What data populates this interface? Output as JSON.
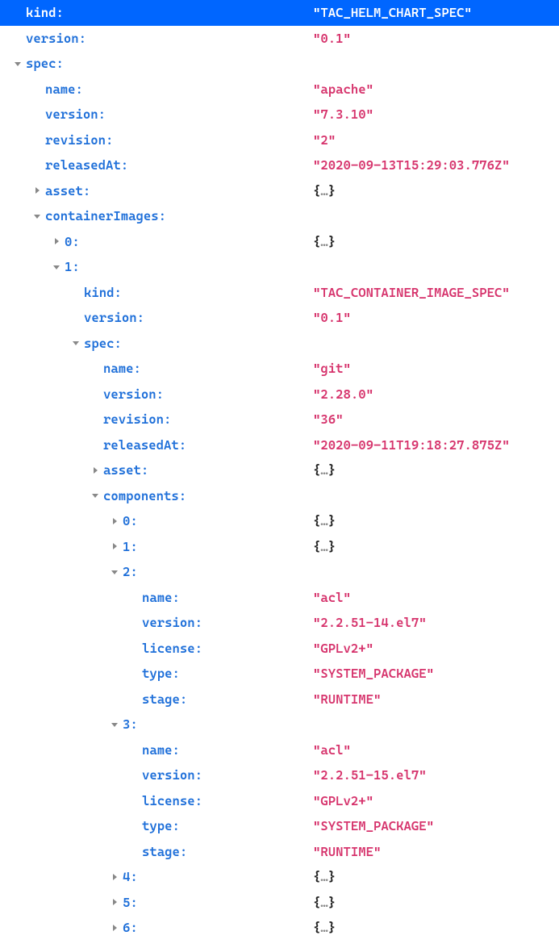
{
  "rows": {
    "r0": {
      "key": "kind:",
      "value": "\"TAC_HELM_CHART_SPEC\""
    },
    "r1": {
      "key": "version:",
      "value": "\"0.1\""
    },
    "r2": {
      "key": "spec:"
    },
    "r3": {
      "key": "name:",
      "value": "\"apache\""
    },
    "r4": {
      "key": "version:",
      "value": "\"7.3.10\""
    },
    "r5": {
      "key": "revision:",
      "value": "\"2\""
    },
    "r6": {
      "key": "releasedAt:",
      "value": "\"2020-09-13T15:29:03.776Z\""
    },
    "r7": {
      "key": "asset:",
      "collapsed": "{…}"
    },
    "r8": {
      "key": "containerImages:"
    },
    "r9": {
      "key": "0:",
      "collapsed": "{…}"
    },
    "r10": {
      "key": "1:"
    },
    "r11": {
      "key": "kind:",
      "value": "\"TAC_CONTAINER_IMAGE_SPEC\""
    },
    "r12": {
      "key": "version:",
      "value": "\"0.1\""
    },
    "r13": {
      "key": "spec:"
    },
    "r14": {
      "key": "name:",
      "value": "\"git\""
    },
    "r15": {
      "key": "version:",
      "value": "\"2.28.0\""
    },
    "r16": {
      "key": "revision:",
      "value": "\"36\""
    },
    "r17": {
      "key": "releasedAt:",
      "value": "\"2020-09-11T19:18:27.875Z\""
    },
    "r18": {
      "key": "asset:",
      "collapsed": "{…}"
    },
    "r19": {
      "key": "components:"
    },
    "r20": {
      "key": "0:",
      "collapsed": "{…}"
    },
    "r21": {
      "key": "1:",
      "collapsed": "{…}"
    },
    "r22": {
      "key": "2:"
    },
    "r23": {
      "key": "name:",
      "value": "\"acl\""
    },
    "r24": {
      "key": "version:",
      "value": "\"2.2.51-14.el7\""
    },
    "r25": {
      "key": "license:",
      "value": "\"GPLv2+\""
    },
    "r26": {
      "key": "type:",
      "value": "\"SYSTEM_PACKAGE\""
    },
    "r27": {
      "key": "stage:",
      "value": "\"RUNTIME\""
    },
    "r28": {
      "key": "3:"
    },
    "r29": {
      "key": "name:",
      "value": "\"acl\""
    },
    "r30": {
      "key": "version:",
      "value": "\"2.2.51-15.el7\""
    },
    "r31": {
      "key": "license:",
      "value": "\"GPLv2+\""
    },
    "r32": {
      "key": "type:",
      "value": "\"SYSTEM_PACKAGE\""
    },
    "r33": {
      "key": "stage:",
      "value": "\"RUNTIME\""
    },
    "r34": {
      "key": "4:",
      "collapsed": "{…}"
    },
    "r35": {
      "key": "5:",
      "collapsed": "{…}"
    },
    "r36": {
      "key": "6:",
      "collapsed": "{…}"
    }
  }
}
